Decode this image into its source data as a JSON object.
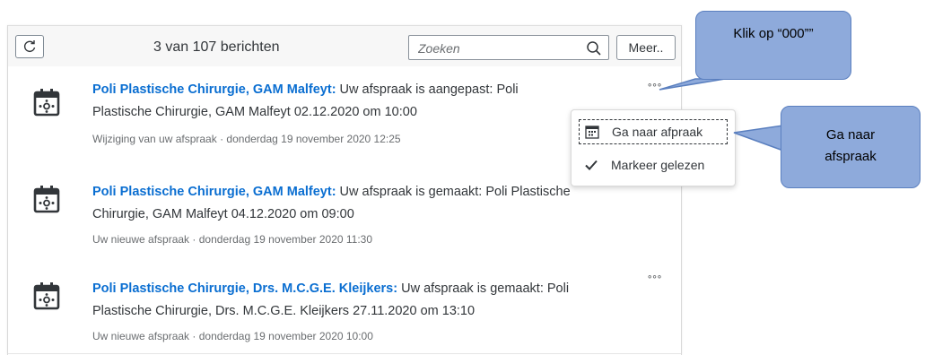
{
  "toolbar": {
    "message_count": "3 van 107 berichten",
    "search_placeholder": "Zoeken",
    "more_label": "Meer.."
  },
  "messages": [
    {
      "sender": "Poli Plastische Chirurgie, GAM Malfeyt:",
      "body_line1": " Uw afspraak is aangepast: Poli",
      "body_line2": "Plastische Chirurgie, GAM Malfeyt 02.12.2020 om 10:00",
      "category": "Wijziging van uw afspraak",
      "separator": "·",
      "timestamp": "donderdag 19 november 2020 12:25",
      "more_icon": "ellipsis-icon"
    },
    {
      "sender": "Poli Plastische Chirurgie, GAM Malfeyt:",
      "body_line1": " Uw afspraak is gemaakt: Poli Plastische",
      "body_line2": "Chirurgie, GAM Malfeyt 04.12.2020 om 09:00",
      "category": "Uw nieuwe afspraak",
      "separator": "·",
      "timestamp": "donderdag 19 november 2020 11:30",
      "more_icon": "ellipsis-icon"
    },
    {
      "sender": "Poli Plastische Chirurgie, Drs. M.C.G.E. Kleijkers:",
      "body_line1": " Uw afspraak is gemaakt: Poli",
      "body_line2": "Plastische Chirurgie, Drs. M.C.G.E. Kleijkers 27.11.2020 om 13:10",
      "category": "Uw nieuwe afspraak",
      "separator": "·",
      "timestamp": "donderdag 19 november 2020 10:00",
      "more_icon": "ellipsis-icon"
    }
  ],
  "action_menu": {
    "items": [
      {
        "label": "Ga naar afpraak",
        "icon": "calendar-icon"
      },
      {
        "label": "Markeer gelezen",
        "icon": "checkmark-icon"
      }
    ]
  },
  "callouts": {
    "click_more": "Klik op “000””",
    "go_to_line1": "Ga naar",
    "go_to_line2": "afspraak"
  },
  "colors": {
    "sender_link": "#0a6ed1",
    "callout_fill": "#8eaadb",
    "callout_border": "#5a7fbf"
  }
}
